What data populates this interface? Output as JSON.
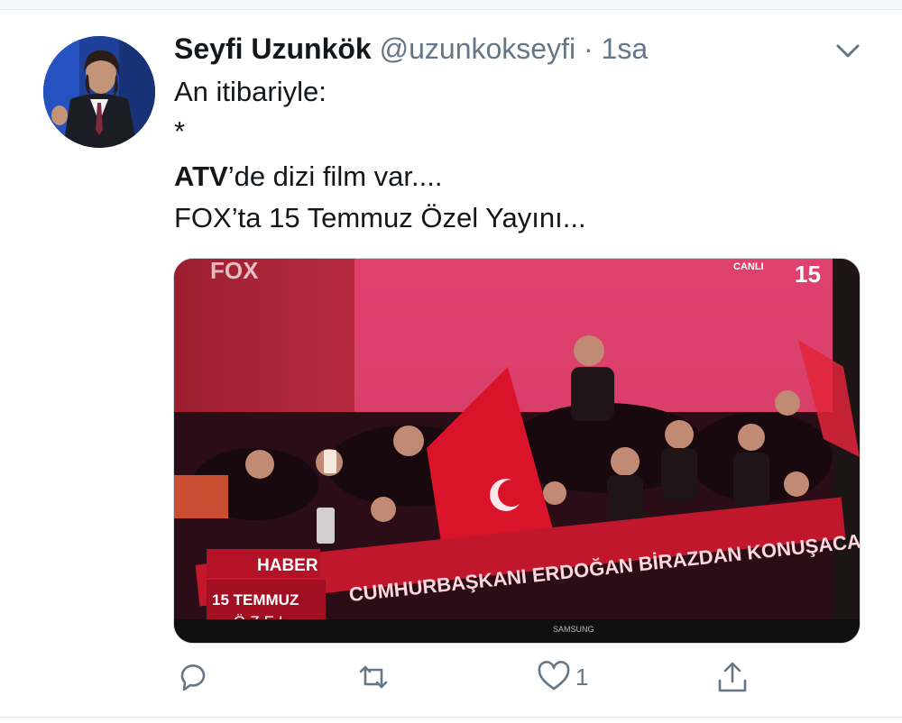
{
  "tweet": {
    "author_name": "Seyfi Uzunkök",
    "handle": "@uzunkokseyfi",
    "separator": "·",
    "time": "1sa",
    "lines": {
      "line1": "An itibariyle:",
      "line2": "*",
      "line3_bold": "ATV",
      "line3_rest": "’de dizi film var....",
      "line4": "FOX’ta 15 Temmuz Özel Yayını..."
    }
  },
  "media": {
    "channel_logo": "FOX",
    "live_label": "CANLI",
    "corner_badge": "15",
    "ticker_tag": "HABER",
    "ticker_headline": "CUMHURBAŞKANI ERDOĞAN BİRAZDAN KONUŞACAK",
    "program_line1": "15 TEMMUZ",
    "program_line2": "ÖZEL",
    "tv_brand": "SAMSUNG"
  },
  "actions": {
    "like_count": "1"
  },
  "icons": {
    "menu": "chevron-down-icon",
    "reply": "reply-icon",
    "retweet": "retweet-icon",
    "like": "heart-icon",
    "share": "share-icon"
  },
  "colors": {
    "text": "#14171a",
    "secondary": "#657786",
    "border": "#e1e8ed"
  }
}
